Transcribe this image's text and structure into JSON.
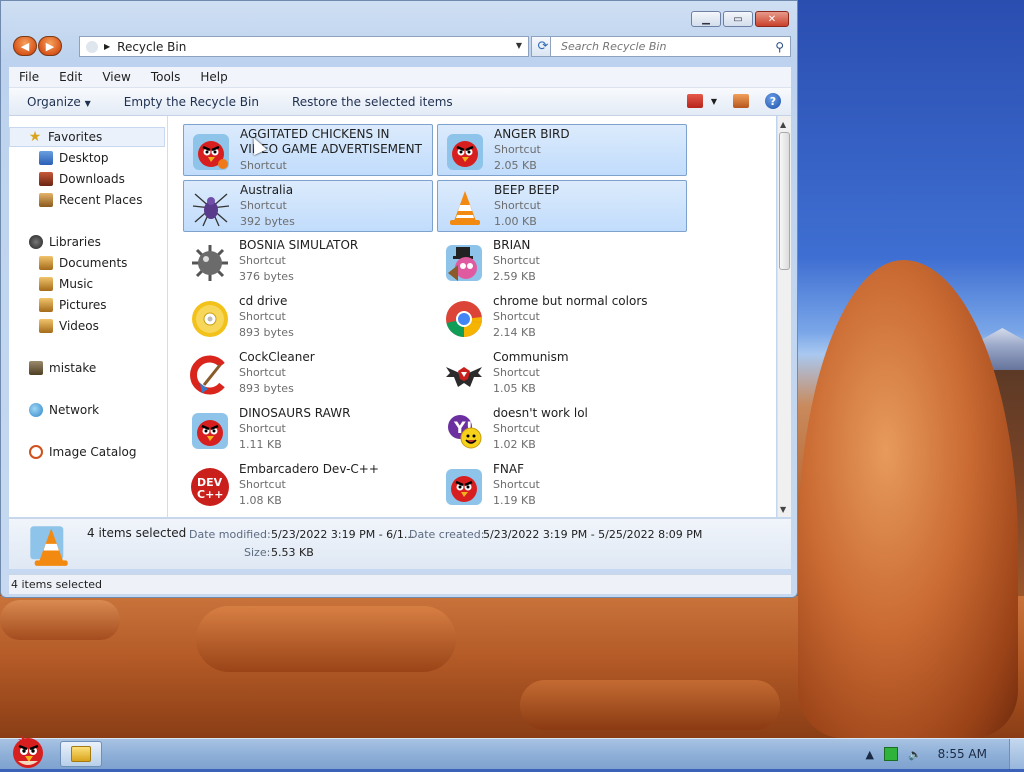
{
  "window": {
    "address": "Recycle Bin",
    "search_placeholder": "Search Recycle Bin"
  },
  "menubar": [
    "File",
    "Edit",
    "View",
    "Tools",
    "Help"
  ],
  "toolbar": {
    "organize": "Organize",
    "empty": "Empty the Recycle Bin",
    "restore": "Restore the selected items"
  },
  "nav": {
    "favorites": "Favorites",
    "desktop": "Desktop",
    "downloads": "Downloads",
    "recent": "Recent Places",
    "libraries": "Libraries",
    "documents": "Documents",
    "music": "Music",
    "pictures": "Pictures",
    "videos": "Videos",
    "mistake": "mistake",
    "network": "Network",
    "catalog": "Image Catalog"
  },
  "files": [
    {
      "name": "AGGITATED CHICKENS IN VIDEO GAME ADVERTISEMENT",
      "type": "Shortcut",
      "size": "",
      "selected": true,
      "icon": "angry-bird-icon"
    },
    {
      "name": "ANGER BIRD",
      "type": "Shortcut",
      "size": "2.05 KB",
      "selected": true,
      "icon": "angry-bird-icon"
    },
    {
      "name": "Australia",
      "type": "Shortcut",
      "size": "392 bytes",
      "selected": true,
      "icon": "spider-icon"
    },
    {
      "name": "BEEP BEEP",
      "type": "Shortcut",
      "size": "1.00 KB",
      "selected": true,
      "icon": "vlc-cone-icon"
    },
    {
      "name": "BOSNIA SIMULATOR",
      "type": "Shortcut",
      "size": "376 bytes",
      "selected": false,
      "icon": "mine-icon"
    },
    {
      "name": "BRIAN",
      "type": "Shortcut",
      "size": "2.59 KB",
      "selected": false,
      "icon": "angry-bird-icon"
    },
    {
      "name": "cd drive",
      "type": "Shortcut",
      "size": "893 bytes",
      "selected": false,
      "icon": "cd-icon"
    },
    {
      "name": "chrome but normal colors",
      "type": "Shortcut",
      "size": "2.14 KB",
      "selected": false,
      "icon": "chrome-icon"
    },
    {
      "name": "CockCleaner",
      "type": "Shortcut",
      "size": "893 bytes",
      "selected": false,
      "icon": "ccleaner-icon"
    },
    {
      "name": "Communism",
      "type": "Shortcut",
      "size": "1.05 KB",
      "selected": false,
      "icon": "eagle-emblem-icon"
    },
    {
      "name": "DINOSAURS RAWR",
      "type": "Shortcut",
      "size": "1.11 KB",
      "selected": false,
      "icon": "angry-bird-icon"
    },
    {
      "name": "doesn't work lol",
      "type": "Shortcut",
      "size": "1.02 KB",
      "selected": false,
      "icon": "yahoo-messenger-icon"
    },
    {
      "name": "Embarcadero Dev-C++",
      "type": "Shortcut",
      "size": "1.08 KB",
      "selected": false,
      "icon": "devcpp-icon"
    },
    {
      "name": "FNAF",
      "type": "Shortcut",
      "size": "1.19 KB",
      "selected": false,
      "icon": "angry-bird-icon"
    }
  ],
  "details": {
    "selected": "4 items selected",
    "modified_label": "Date modified:",
    "modified_value": "5/23/2022 3:19 PM - 6/1...",
    "created_label": "Date created:",
    "created_value": "5/23/2022 3:19 PM - 5/25/2022 8:09 PM",
    "size_label": "Size:",
    "size_value": "5.53 KB"
  },
  "status": "4 items selected",
  "taskbar": {
    "clock": "8:55 AM"
  }
}
